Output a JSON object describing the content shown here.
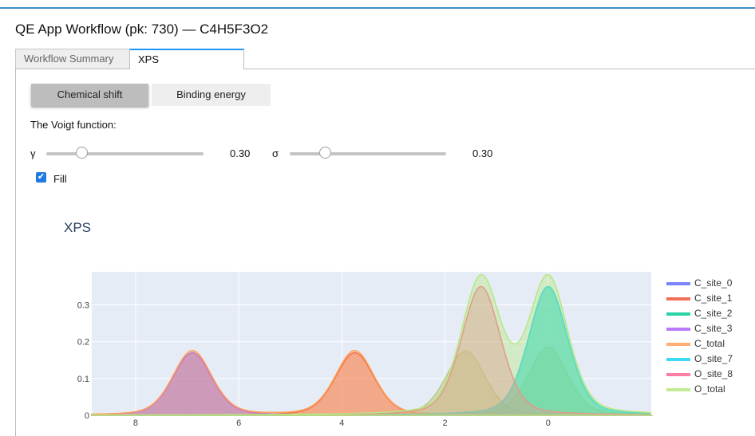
{
  "header": {
    "title": "QE App Workflow (pk: 730) — C4H5F3O2"
  },
  "tabs": [
    {
      "label": "Workflow Summary",
      "active": false
    },
    {
      "label": "XPS",
      "active": true
    }
  ],
  "mode_toggle": {
    "options": [
      "Chemical shift",
      "Binding energy"
    ],
    "selected": "Chemical shift"
  },
  "voigt": {
    "label": "The Voigt function:",
    "gamma": {
      "symbol": "γ",
      "value_text": "0.30",
      "value": 0.3,
      "min": 0.1,
      "max": 1.0
    },
    "sigma": {
      "symbol": "σ",
      "value_text": "0.30",
      "value": 0.3,
      "min": 0.1,
      "max": 1.0
    }
  },
  "fill": {
    "label": "Fill",
    "checked": true
  },
  "chart_data": {
    "type": "area",
    "title": "XPS",
    "xlabel": "",
    "ylabel": "",
    "x_reversed": true,
    "xlim": [
      8.85,
      -2.0
    ],
    "ylim": [
      0,
      0.39
    ],
    "x_ticks": [
      8,
      6,
      4,
      2,
      0
    ],
    "y_ticks": [
      0,
      0.1,
      0.2,
      0.3
    ],
    "y_tick_labels": [
      "0",
      "0.1",
      "0.2",
      "0.3"
    ],
    "grid": true,
    "legend_position": "right",
    "voigt_fwhm": 0.9,
    "series": [
      {
        "name": "C_site_0",
        "color": "#636efa",
        "peaks": [
          {
            "center": 6.9,
            "height": 0.17
          }
        ]
      },
      {
        "name": "C_site_1",
        "color": "#ef553b",
        "peaks": [
          {
            "center": 3.75,
            "height": 0.17
          }
        ]
      },
      {
        "name": "C_site_2",
        "color": "#00cc96",
        "peaks": [
          {
            "center": 0.0,
            "height": 0.35
          }
        ]
      },
      {
        "name": "C_site_3",
        "color": "#ab63fa",
        "peaks": [
          {
            "center": 6.9,
            "height": 0.17
          }
        ]
      },
      {
        "name": "C_total",
        "color": "#ffa15a",
        "peaks": [
          {
            "center": 6.9,
            "height": 0.175
          },
          {
            "center": 3.75,
            "height": 0.175
          }
        ]
      },
      {
        "name": "O_site_7",
        "color": "#19d3f3",
        "peaks": [
          {
            "center": 0.0,
            "height": 0.35
          }
        ]
      },
      {
        "name": "O_site_8",
        "color": "#ff6692",
        "peaks": [
          {
            "center": 1.3,
            "height": 0.35
          }
        ]
      },
      {
        "name": "O_total",
        "color": "#b6e880",
        "peaks": [
          {
            "center": 1.3,
            "height": 0.37
          },
          {
            "center": 0.0,
            "height": 0.37
          }
        ]
      }
    ],
    "background_peaks": [
      {
        "center": 1.6,
        "height": 0.175,
        "color": "#b8c27a"
      },
      {
        "center": 0.0,
        "height": 0.185,
        "color": "#b8c27a"
      }
    ]
  }
}
